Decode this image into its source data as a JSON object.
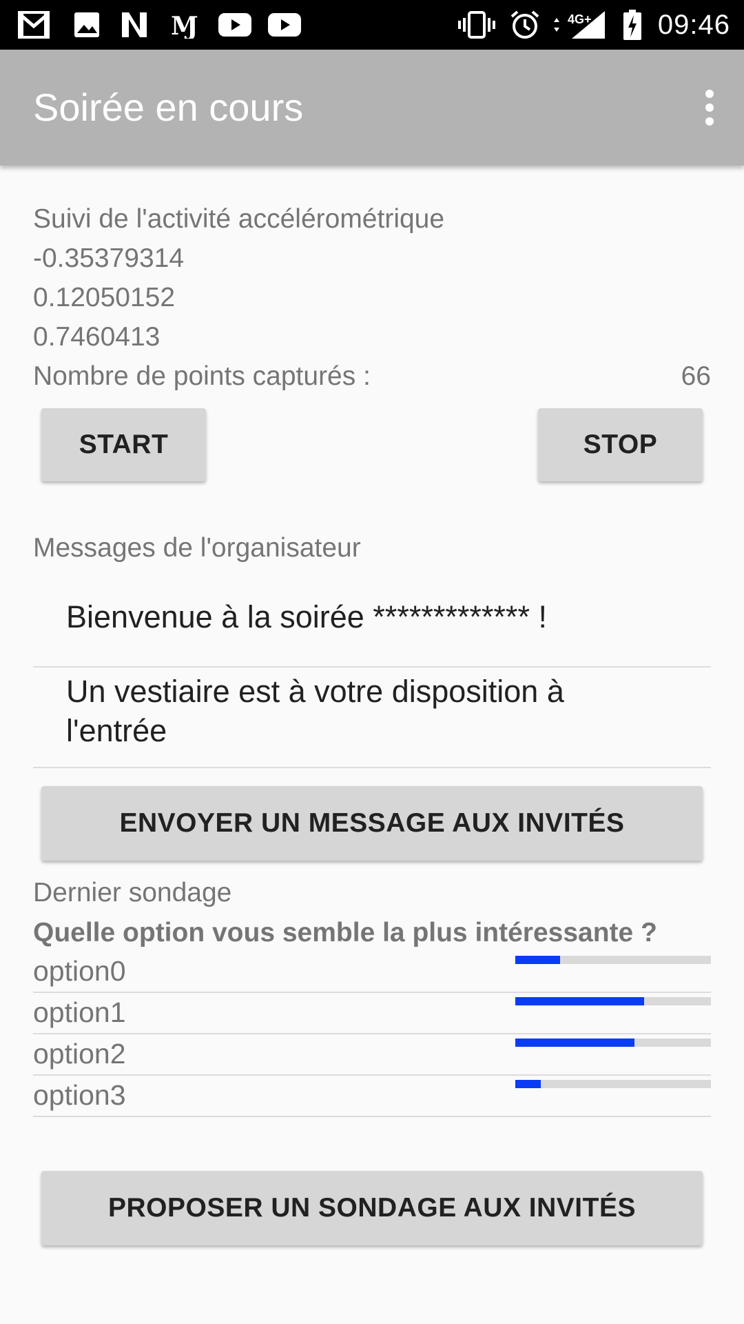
{
  "status_bar": {
    "time": "09:46",
    "network": "4G+",
    "left_icons": [
      "gmail-icon",
      "gallery-icon",
      "netflix-icon",
      "le-monde-icon",
      "youtube-icon",
      "youtube-icon"
    ],
    "right_icons": [
      "vibrate-icon",
      "alarm-icon",
      "signal-icon",
      "battery-charging-icon"
    ]
  },
  "app_bar": {
    "title": "Soirée en cours",
    "menu_icon": "overflow-menu-icon"
  },
  "accelerometer": {
    "heading": "Suivi de l'activité accélérométrique",
    "x": "-0.35379314",
    "y": "0.12050152",
    "z": "0.7460413",
    "points_label": "Nombre de points capturés :",
    "points_value": "66",
    "start_label": "START",
    "stop_label": "STOP"
  },
  "messages": {
    "heading": "Messages de l'organisateur",
    "items": [
      "Bienvenue à la soirée ************* !",
      "Un vestiaire est à votre disposition à l'entrée"
    ],
    "send_label": "ENVOYER UN MESSAGE AUX INVITÉS"
  },
  "poll": {
    "heading": "Dernier sondage",
    "question": "Quelle option vous semble la plus intéressante ?",
    "options": [
      {
        "label": "option0",
        "fraction": 0.23
      },
      {
        "label": "option1",
        "fraction": 0.66
      },
      {
        "label": "option2",
        "fraction": 0.61
      },
      {
        "label": "option3",
        "fraction": 0.13
      }
    ],
    "propose_label": "PROPOSER UN SONDAGE AUX INVITÉS",
    "bar_color": "#0a3cf5"
  },
  "colors": {
    "app_bar": "#b3b3b3",
    "button": "#d6d6d6"
  }
}
